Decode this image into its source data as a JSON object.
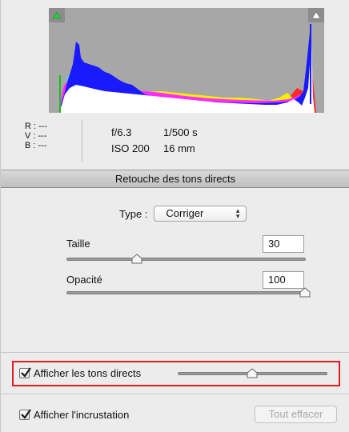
{
  "info": {
    "r_label": "R :",
    "r_value": "---",
    "v_label": "V :",
    "v_value": "---",
    "b_label": "B :",
    "b_value": "---",
    "aperture": "f/6.3",
    "shutter": "1/500 s",
    "iso": "ISO 200",
    "focal": "16 mm"
  },
  "section": {
    "title": "Retouche des tons directs"
  },
  "controls": {
    "type_label": "Type :",
    "type_value": "Corriger",
    "size_label": "Taille",
    "size_value": "30",
    "size_fraction": 0.29,
    "opacity_label": "Opacité",
    "opacity_value": "100",
    "opacity_fraction": 1.0
  },
  "bottom": {
    "show_spots_label": "Afficher les tons directs",
    "show_spots_checked": true,
    "visualize_fraction": 0.5,
    "show_overlay_label": "Afficher l'incrustation",
    "show_overlay_checked": true,
    "clear_all_label": "Tout effacer"
  },
  "colors": {
    "highlight": "#e21b24",
    "shadow_clip": "#27c93f"
  }
}
